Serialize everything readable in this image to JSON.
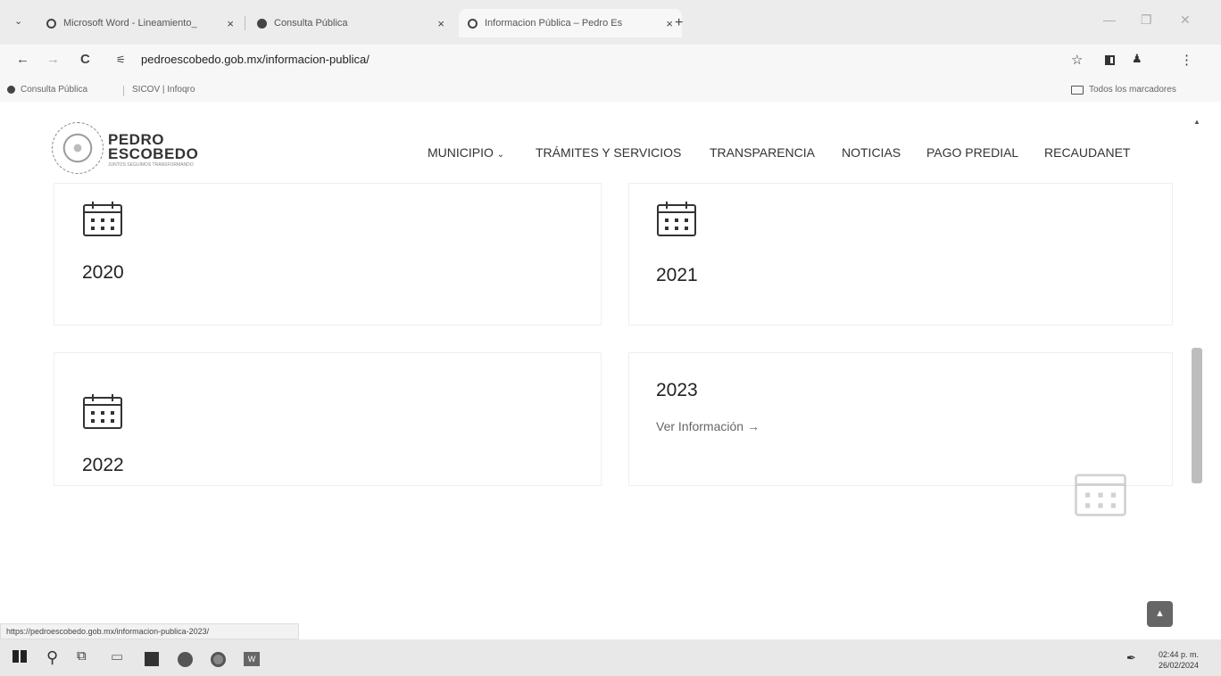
{
  "browser": {
    "tabs": [
      {
        "title": "Microsoft Word - Lineamiento_",
        "close": "×"
      },
      {
        "title": "Consulta Pública",
        "close": "×"
      },
      {
        "title": "Informacion Pública – Pedro Es",
        "close": "×"
      }
    ],
    "new_tab": "+",
    "url": "pedroescobedo.gob.mx/informacion-publica/",
    "bookmarks": [
      "Consulta Pública",
      "SICOV | Infoqro"
    ],
    "all_bookmarks": "Todos los marcadores",
    "status_url": "https://pedroescobedo.gob.mx/informacion-publica-2023/"
  },
  "site": {
    "logo_line1": "PEDRO",
    "logo_line2": "ESCOBEDO",
    "logo_tagline": "JUNTOS SEGUIMOS TRANSFORMANDO",
    "nav": [
      "MUNICIPIO",
      "TRÁMITES Y SERVICIOS",
      "TRANSPARENCIA",
      "NOTICIAS",
      "PAGO PREDIAL",
      "RECAUDANET"
    ],
    "nav_caret": "⌄"
  },
  "cards": [
    {
      "year": "2020"
    },
    {
      "year": "2021"
    },
    {
      "year": "2022"
    },
    {
      "year": "2023",
      "link": "Ver Información →"
    }
  ],
  "clock": {
    "time": "02:44 p. m.",
    "date": "26/02/2024"
  },
  "icons": {
    "back": "←",
    "forward": "→",
    "reload": "C",
    "star": "☆",
    "more": "⋮"
  }
}
